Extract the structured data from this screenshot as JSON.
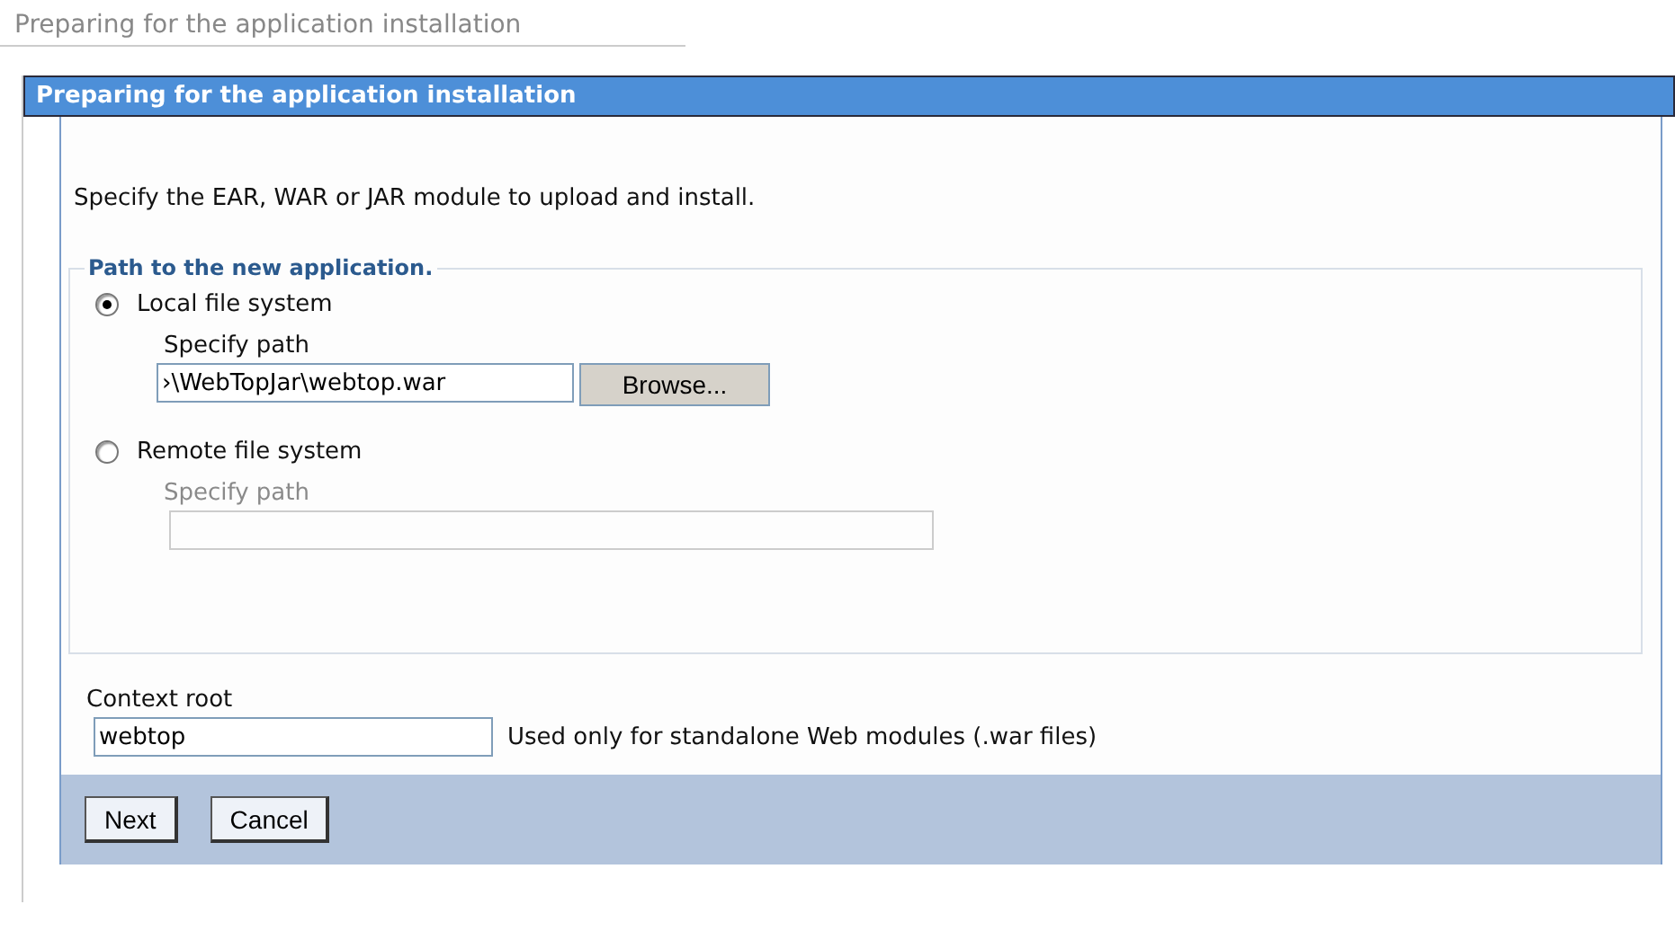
{
  "page_title": "Preparing for the application installation",
  "panel": {
    "title": "Preparing for the application installation",
    "instruction": "Specify the EAR, WAR or JAR module to upload and install.",
    "fieldset": {
      "legend": "Path to the new application.",
      "options": [
        {
          "label": "Local file system",
          "selected": true,
          "path_label": "Specify path",
          "path_value": "›\\WebTopJar\\webtop.war",
          "disabled": false,
          "button": "Browse..."
        },
        {
          "label": "Remote file system",
          "selected": false,
          "path_label": "Specify path",
          "disabled": true
        }
      ]
    },
    "context_root": {
      "label": "Context root",
      "value": "webtop",
      "hint": "Used only for standalone Web modules (.war files)"
    },
    "buttons": [
      "Next",
      "Cancel"
    ]
  }
}
